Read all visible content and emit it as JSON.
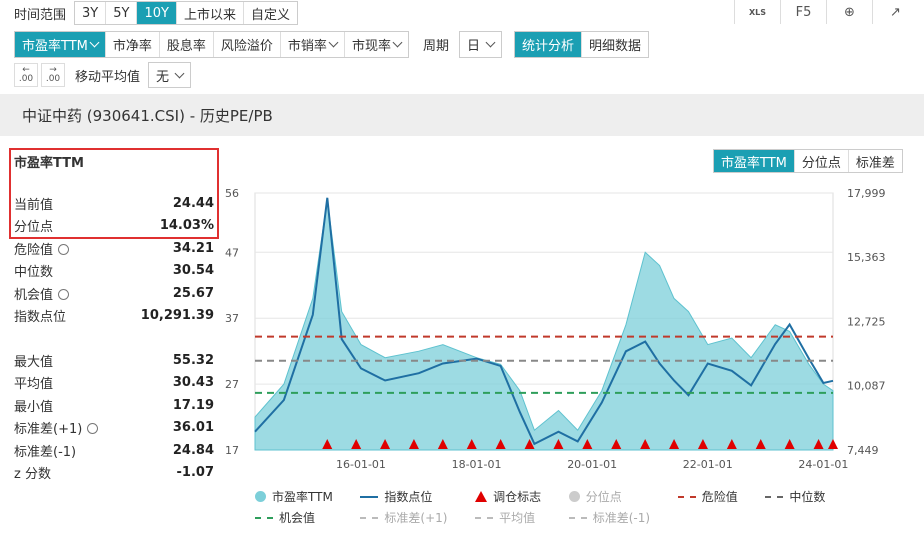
{
  "toolbar": {
    "range_label": "时间范围",
    "ranges": [
      "3Y",
      "5Y",
      "10Y",
      "上市以来",
      "自定义"
    ],
    "active_range": "10Y",
    "icons": [
      {
        "name": "xls-icon",
        "text": "XLS"
      },
      {
        "name": "f5-refresh-icon",
        "text": "F5"
      },
      {
        "name": "plus-circle-icon",
        "text": "⊕"
      },
      {
        "name": "external-link-icon",
        "text": "↗"
      }
    ]
  },
  "metrics": {
    "items": [
      "市盈率TTM",
      "市净率",
      "股息率",
      "风险溢价",
      "市销率",
      "市现率"
    ],
    "active": "市盈率TTM",
    "period_label": "周期",
    "period_value": "日",
    "view_tabs": [
      "统计分析",
      "明细数据"
    ],
    "active_view": "统计分析"
  },
  "options": {
    "decimal_up": ".00",
    "decimal_down": ".00",
    "ma_label": "移动平均值",
    "ma_value": "无"
  },
  "title": "中证中药 (930641.CSI) - 历史PE/PB",
  "stats": {
    "header": "市盈率TTM",
    "rows1": [
      {
        "label": "当前值",
        "value": "24.44"
      },
      {
        "label": "分位点",
        "value": "14.03%"
      },
      {
        "label": "危险值",
        "value": "34.21",
        "gear": true
      },
      {
        "label": "中位数",
        "value": "30.54"
      },
      {
        "label": "机会值",
        "value": "25.67",
        "gear": true
      },
      {
        "label": "指数点位",
        "value": "10,291.39"
      }
    ],
    "rows2": [
      {
        "label": "最大值",
        "value": "55.32"
      },
      {
        "label": "平均值",
        "value": "30.43"
      },
      {
        "label": "最小值",
        "value": "17.19"
      },
      {
        "label": "标准差(+1)",
        "value": "36.01",
        "gear": true
      },
      {
        "label": "标准差(-1)",
        "value": "24.84"
      },
      {
        "label": "z 分数",
        "value": "-1.07"
      }
    ]
  },
  "chart_tabs": [
    "市盈率TTM",
    "分位点",
    "标准差"
  ],
  "chart_active_tab": "市盈率TTM",
  "colors": {
    "accent": "#1b9fb3",
    "area": "#7ccfd9",
    "index_line": "#1f6fa3",
    "danger": "#c0392b",
    "median": "#888888",
    "opportunity": "#2e9e5b",
    "marker": "#e00000"
  },
  "legend": [
    {
      "label": "市盈率TTM",
      "kind": "dot",
      "color": "#7ccfd9"
    },
    {
      "label": "指数点位",
      "kind": "line",
      "color": "#1f6fa3"
    },
    {
      "label": "调仓标志",
      "kind": "tri",
      "color": "#e00000"
    },
    {
      "label": "分位点",
      "kind": "dot",
      "color": "#cccccc",
      "muted": true
    },
    {
      "label": "危险值",
      "kind": "dash",
      "color": "#c0392b"
    },
    {
      "label": "中位数",
      "kind": "dash",
      "color": "#666666"
    },
    {
      "label": "机会值",
      "kind": "dash",
      "color": "#2e9e5b"
    },
    {
      "label": "标准差(+1)",
      "kind": "dash",
      "color": "#bbbbbb",
      "muted": true
    },
    {
      "label": "平均值",
      "kind": "dash",
      "color": "#bbbbbb",
      "muted": true
    },
    {
      "label": "标准差(-1)",
      "kind": "dash",
      "color": "#bbbbbb",
      "muted": true
    }
  ],
  "chart_data": {
    "type": "area",
    "x_ticks": [
      "16-01-01",
      "18-01-01",
      "20-01-01",
      "22-01-01",
      "24-01-01"
    ],
    "x_range": [
      "2014-03-01",
      "2024-03-01"
    ],
    "y_left_ticks": [
      "56",
      "47",
      "37",
      "27",
      "17"
    ],
    "y_left_range": [
      17,
      56
    ],
    "y_right_ticks": [
      "17,999",
      "15,363",
      "12,725",
      "10,087",
      "7,449"
    ],
    "y_right_range": [
      7449,
      17999
    ],
    "reference_lines": {
      "危险值": 34.21,
      "中位数": 30.54,
      "机会值": 25.67
    },
    "series": [
      {
        "name": "市盈率TTM",
        "axis": "left",
        "x": [
          "2014-03",
          "2014-09",
          "2015-03",
          "2015-06",
          "2015-09",
          "2016-01",
          "2016-06",
          "2017-01",
          "2017-06",
          "2018-01",
          "2018-06",
          "2018-10",
          "2019-01",
          "2019-06",
          "2019-10",
          "2020-03",
          "2020-08",
          "2020-12",
          "2021-03",
          "2021-06",
          "2021-09",
          "2022-01",
          "2022-06",
          "2022-10",
          "2023-03",
          "2023-06",
          "2023-10",
          "2024-01",
          "2024-03"
        ],
        "values": [
          22,
          27,
          40,
          55,
          38,
          33,
          31,
          32,
          33,
          31,
          30,
          26,
          20,
          23,
          20,
          26,
          36,
          47,
          45,
          40,
          38,
          33,
          34,
          31,
          36,
          35,
          30,
          27,
          26
        ]
      },
      {
        "name": "指数点位",
        "axis": "right",
        "x": [
          "2014-03",
          "2014-09",
          "2015-03",
          "2015-06",
          "2015-09",
          "2016-01",
          "2016-06",
          "2017-01",
          "2017-06",
          "2018-01",
          "2018-06",
          "2018-10",
          "2019-01",
          "2019-06",
          "2019-10",
          "2020-03",
          "2020-08",
          "2020-12",
          "2021-03",
          "2021-06",
          "2021-09",
          "2022-01",
          "2022-06",
          "2022-10",
          "2023-03",
          "2023-06",
          "2023-10",
          "2024-01",
          "2024-03"
        ],
        "values": [
          8200,
          9500,
          13000,
          17800,
          12000,
          10800,
          10300,
          10600,
          11000,
          11200,
          10900,
          9000,
          7700,
          8200,
          7800,
          9400,
          11500,
          11900,
          11000,
          10300,
          9700,
          11000,
          10700,
          10100,
          11800,
          12600,
          11200,
          10200,
          10291
        ]
      }
    ],
    "rebalance_markers": [
      "2015-06",
      "2015-12",
      "2016-06",
      "2016-12",
      "2017-06",
      "2017-12",
      "2018-06",
      "2018-12",
      "2019-06",
      "2019-12",
      "2020-06",
      "2020-12",
      "2021-06",
      "2021-12",
      "2022-06",
      "2022-12",
      "2023-06",
      "2023-12",
      "2024-03"
    ]
  }
}
